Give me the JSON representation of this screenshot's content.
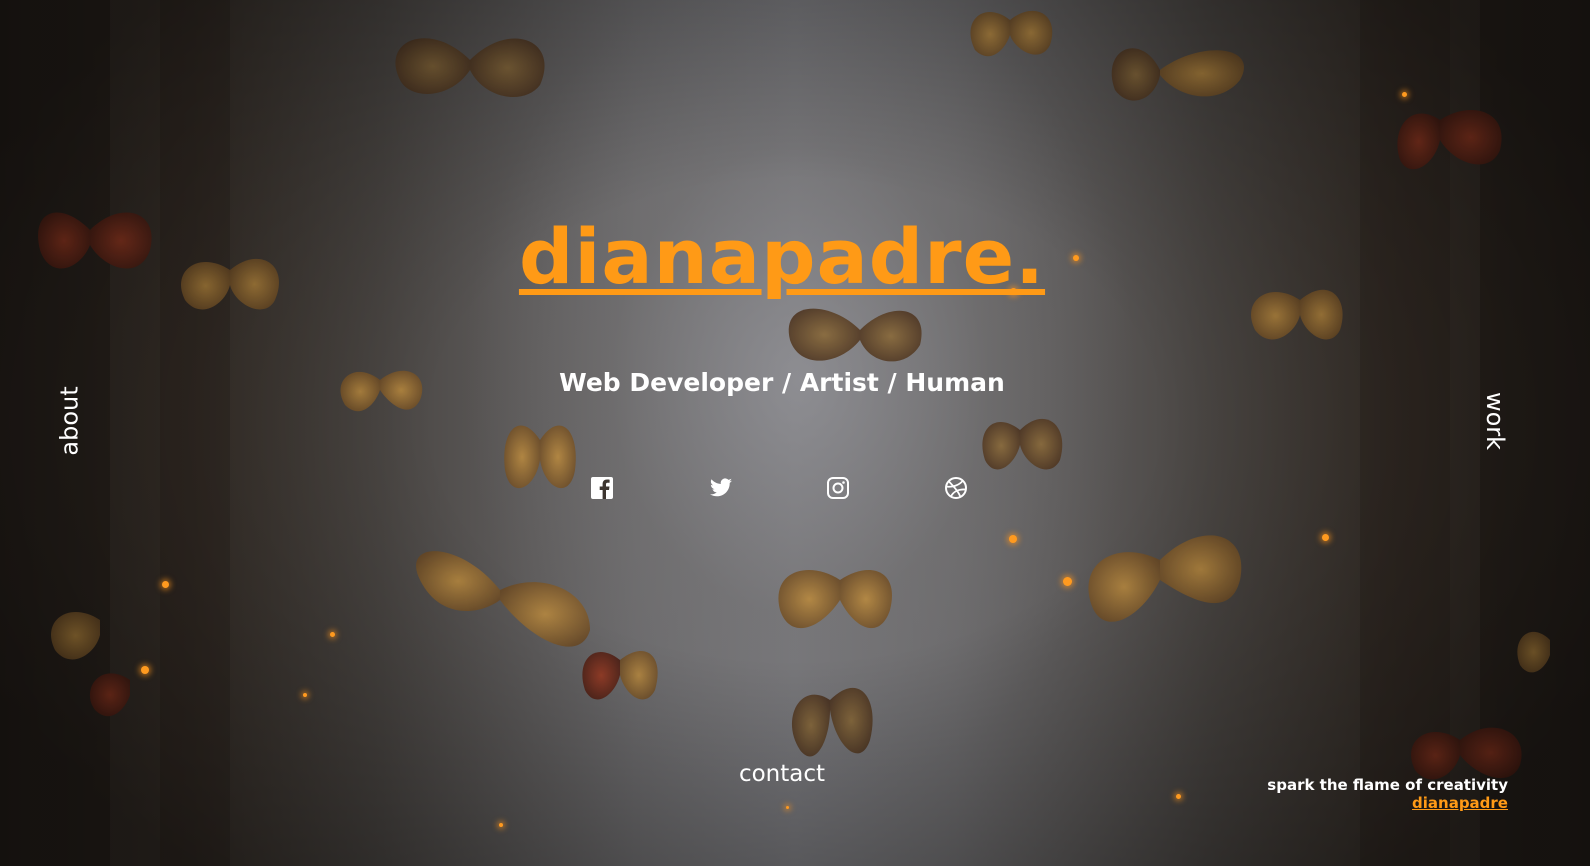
{
  "site": {
    "logo_text": "dianapadre.",
    "subtitle": "Web Developer / Artist / Human",
    "accent_color": "#ff9a16"
  },
  "nav": {
    "about": "about",
    "work": "work",
    "contact": "contact"
  },
  "socials": [
    {
      "name": "facebook",
      "icon": "facebook-icon"
    },
    {
      "name": "twitter",
      "icon": "twitter-icon"
    },
    {
      "name": "instagram",
      "icon": "instagram-icon"
    },
    {
      "name": "dribbble",
      "icon": "dribbble-icon"
    }
  ],
  "footer": {
    "tagline": "spark the flame of creativity",
    "signature": "dianapadre"
  }
}
